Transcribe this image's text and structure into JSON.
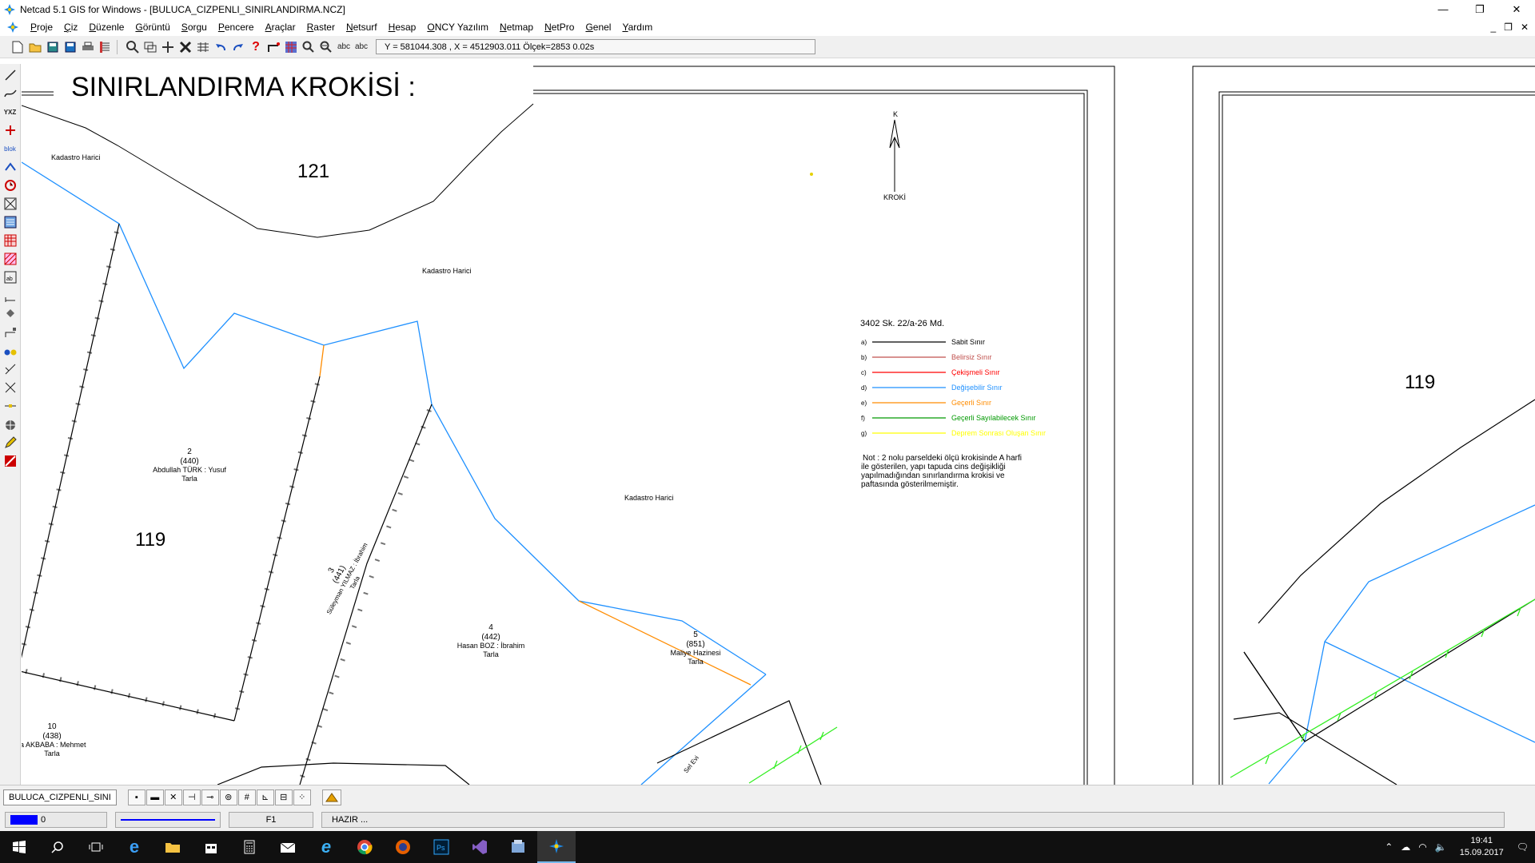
{
  "window": {
    "title": "Netcad 5.1 GIS for Windows - [BULUCA_CIZPENLI_SINIRLANDIRMA.NCZ]",
    "minimize": "—",
    "maximize": "❐",
    "close": "✕"
  },
  "menu": {
    "items": [
      "Proje",
      "Çiz",
      "Düzenle",
      "Görüntü",
      "Sorgu",
      "Pencere",
      "Araçlar",
      "Raster",
      "Netsurf",
      "Hesap",
      "ONCY Yazılım",
      "Netmap",
      "NetPro",
      "Genel",
      "Yardım"
    ],
    "mdi_minimize": "_",
    "mdi_restore": "❐",
    "mdi_close": "✕"
  },
  "toolbar": {
    "coord_readout": "Y = 581044.308 , X = 4512903.011  Ölçek=2853   0.02s"
  },
  "drawing": {
    "heading": "SINIRLANDIRMA KROKİSİ  :",
    "north_letter": "K",
    "north_caption": "KROKİ",
    "labels": {
      "kadastro_harici_1": "Kadastro Harici",
      "kadastro_harici_2": "Kadastro Harici",
      "kadastro_harici_3": "Kadastro Harici",
      "block_121": "121",
      "block_119": "119",
      "block_119_right": "119",
      "p2_no": "2",
      "p2_ref": "(440)",
      "p2_owner": "Abdullah TÜRK : Yusuf",
      "p2_use": "Tarla",
      "p3_no": "3",
      "p3_ref": "(441)",
      "p3_owner": "Süleyman YILMAZ : İbrahim",
      "p3_use": "Tarla",
      "p4_no": "4",
      "p4_ref": "(442)",
      "p4_owner": "Hasan BOZ : İbrahim",
      "p4_use": "Tarla",
      "p5_no": "5",
      "p5_ref": "(851)",
      "p5_owner": "Maliye Hazinesi",
      "p5_use": "Tarla",
      "p10_no": "10",
      "p10_ref": "(438)",
      "p10_owner": "fa AKBABA : Mehmet",
      "p10_use": "Tarla",
      "road": "Sel Evi"
    },
    "legend": {
      "title": "3402 Sk. 22/a-26 Md.",
      "items": [
        {
          "key": "a)",
          "label": "Sabit Sınır",
          "color": "#000000"
        },
        {
          "key": "b)",
          "label": "Belirsiz Sınır",
          "color": "#c0504d"
        },
        {
          "key": "c)",
          "label": "Çekişmeli Sınır",
          "color": "#ff0000"
        },
        {
          "key": "d)",
          "label": "Değişebilir Sınır",
          "color": "#1e90ff"
        },
        {
          "key": "e)",
          "label": "Geçerli Sınır",
          "color": "#ff8c00"
        },
        {
          "key": "f)",
          "label": "Geçerli Sayılabilecek Sınır",
          "color": "#009900"
        },
        {
          "key": "g)",
          "label": "Deprem Sonrası Oluşan Sınır",
          "color": "#ffff00"
        }
      ]
    },
    "note": [
      "Not : 2 nolu parseldeki ölçü krokisinde A harfi",
      "ile gösterilen,  yapı tapuda cins değişikliği",
      "yapılmadığından sınırlandırma krokisi ve",
      "paftasında gösterilmemiştir."
    ]
  },
  "tabbar": {
    "drawing_name": "BULUCA_CIZPENLI_SINI"
  },
  "statusbar": {
    "layer_value": "0",
    "function_key": "F1",
    "status": "HAZIR ..."
  },
  "taskbar": {
    "time": "19:41",
    "date": "15.09.2017"
  },
  "colors": {
    "blue_boundary": "#1e90ff",
    "orange_boundary": "#ff8c00",
    "green_line": "#33ee22"
  }
}
